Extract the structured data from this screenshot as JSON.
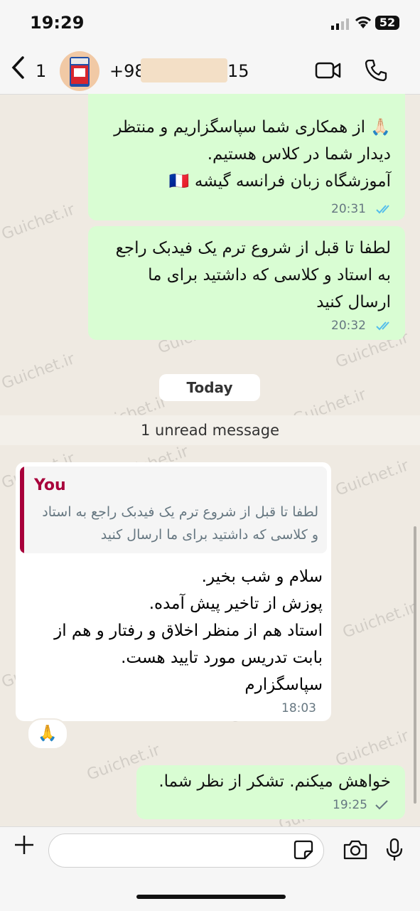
{
  "status_bar": {
    "time": "19:29",
    "battery": "52"
  },
  "header": {
    "back_count": "1",
    "phone_prefix": "+98",
    "phone_suffix": "15"
  },
  "messages": [
    {
      "direction": "outgoing",
      "lines": [
        "🙏🏻 از همکاری شما سپاسگزاریم و منتظر",
        "دیدار شما در کلاس هستیم.",
        "آموزشگاه زبان فرانسه گیشه 🇫🇷"
      ],
      "time": "20:31"
    },
    {
      "direction": "outgoing",
      "lines": [
        "لطفا تا قبل از شروع ترم یک فیدبک راجع",
        "به استاد و کلاسی که داشتید برای ما",
        "ارسال کنید"
      ],
      "time": "20:32"
    }
  ],
  "date_separator": "Today",
  "unread_banner": "1 unread message",
  "incoming_message": {
    "quote_author": "You",
    "quote_lines": [
      "لطفا تا قبل از شروع ترم یک فیدبک راجع به استاد",
      "و کلاسی که داشتید برای ما ارسال کنید"
    ],
    "lines": [
      "سلام و شب بخیر.",
      "پوزش از تاخیر پیش آمده.",
      "استاد هم از منظر اخلاق و رفتار و هم از",
      "بابت تدریس مورد تایید هست.",
      "سپاسگزارم"
    ],
    "time": "18:03",
    "reaction": "🙏"
  },
  "reply_message": {
    "text": "خواهش میکنم. تشکر از نظر شما.",
    "time": "19:25"
  },
  "input": {
    "placeholder": ""
  },
  "watermark": "Guichet.ir",
  "colors": {
    "outgoing_bubble": "#d9fdd3",
    "quote_accent": "#a8003b",
    "read_ticks": "#53bdeb",
    "background": "#efeae2"
  }
}
